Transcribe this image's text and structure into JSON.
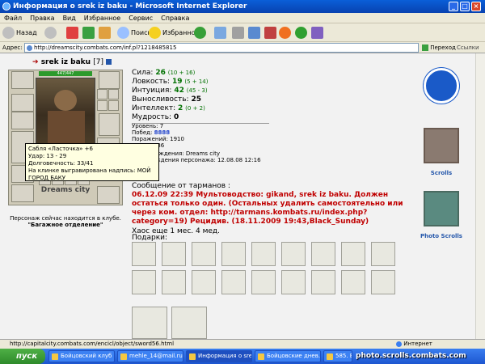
{
  "window": {
    "title": "Информация о srek iz baku - Microsoft Internet Explorer",
    "min": "_",
    "max": "□",
    "close": "×"
  },
  "menu": [
    "Файл",
    "Правка",
    "Вид",
    "Избранное",
    "Сервис",
    "Справка"
  ],
  "toolbar": {
    "back": "Назад",
    "search": "Поиск",
    "favorites": "Избранное"
  },
  "address": {
    "label": "Адрес:",
    "url": "http://dreamscity.combats.com/inf.pl?1218485815",
    "go": "Переход",
    "links": "Ссылки"
  },
  "character": {
    "name": "srek iz baku",
    "level": "[7]",
    "hp": "447/447",
    "city": "Dreams city",
    "location_note": "Персонаж сейчас находится в клубе.",
    "location_room": "\"Багажное отделение\""
  },
  "stats": [
    {
      "label": "Сила:",
      "value": "26",
      "extra": "(10 + 16)"
    },
    {
      "label": "Ловкость:",
      "value": "19",
      "extra": "(5 + 14)"
    },
    {
      "label": "Интуиция:",
      "value": "42",
      "extra": "(45 - 3)"
    },
    {
      "label": "Выносливость:",
      "value": "25",
      "extra": ""
    },
    {
      "label": "Интеллект:",
      "value": "2",
      "extra": "(0 + 2)"
    },
    {
      "label": "Мудрость:",
      "value": "0",
      "extra": ""
    }
  ],
  "info": {
    "level": "Уровень: 7",
    "wins": "Побед:",
    "wins_val": "8888",
    "losses": "Поражений: 1910",
    "draws": "Ничьих: 36",
    "birth_city": "Место рождения: Dreams city",
    "birth_date": "День рождения персонажа: 12.08.08 12:16"
  },
  "tooltip": {
    "line1": "Сабля «Ласточка» +6",
    "line2": "Удар: 13 - 29",
    "line3": "Долговечность: 33/41",
    "line4": "На клинке выгравирована надпись: МОЙ ГОРОД БАКУ"
  },
  "message": {
    "header": "Сообщение от тарманов :",
    "body": "06.12.09 22:39 Мультоводство: gikand, srek iz baku. Должен остаться только один. (Остальных удалить самостоятельно или через ком. отдел: http://tarmans.kombats.ru/index.php?category=19) Рецидив. (18.11.2009 19:43,Black_Sunday)",
    "chaos": "Хаос еще 1 мес. 4 мед."
  },
  "gifts_label": "Подарки:",
  "scrolls": {
    "scrolls": "Scrolls",
    "photo": "Photo Scrolls"
  },
  "status": {
    "url": "http://capitalcity.combats.com/encicl/object/sword56.html",
    "zone": "Интернет"
  },
  "taskbar": {
    "start": "пуск",
    "tasks": [
      "Бойцовский клуб ...",
      "mehle_14@mail.ru...",
      "Информация о sre...",
      "Бойцовские днев...",
      "585. Без..."
    ],
    "watermark": "photo.scrolls.combats.com"
  }
}
